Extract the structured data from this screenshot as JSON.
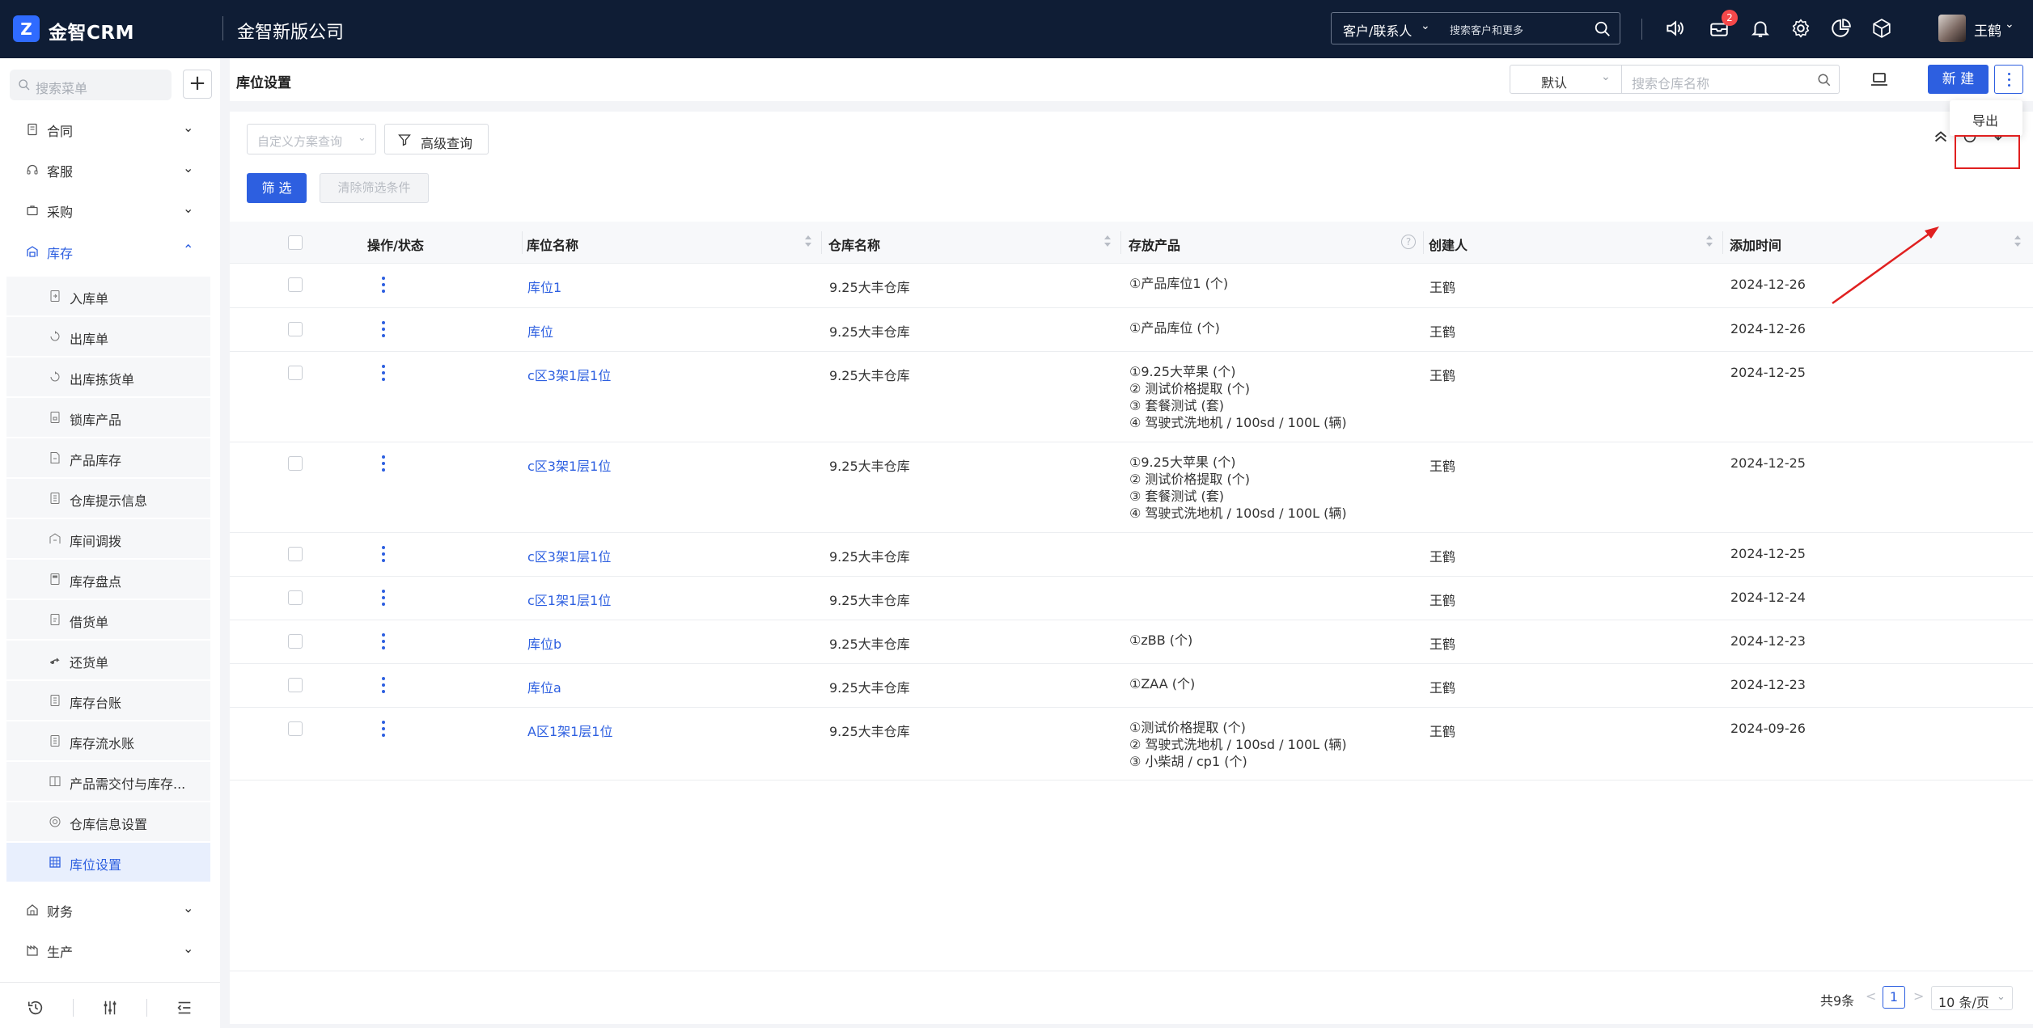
{
  "app": {
    "logo_letter": "Z",
    "brand": "金智CRM",
    "company": "金智新版公司"
  },
  "top_search": {
    "scope": "客户/联系人",
    "placeholder": "搜索客户和更多"
  },
  "notifications": {
    "badge_count": "2"
  },
  "user": {
    "name": "王鹤"
  },
  "sidebar": {
    "search_placeholder": "搜索菜单",
    "add_label": "+",
    "menus": [
      {
        "label": "合同",
        "chevron": "⌄"
      },
      {
        "label": "客服",
        "chevron": "⌄"
      },
      {
        "label": "采购",
        "chevron": "⌄"
      },
      {
        "label": "库存",
        "chevron": "⌃"
      },
      {
        "label": "财务",
        "chevron": "⌄"
      },
      {
        "label": "生产",
        "chevron": "⌄"
      }
    ],
    "inventory_items": [
      "入库单",
      "出库单",
      "出库拣货单",
      "锁库产品",
      "产品库存",
      "仓库提示信息",
      "库间调拨",
      "库存盘点",
      "借货单",
      "还货单",
      "库存台账",
      "库存流水账",
      "产品需交付与库存...",
      "仓库信息设置",
      "库位设置"
    ]
  },
  "header": {
    "title": "库位设置",
    "view_select": "默认",
    "warehouse_search_placeholder": "搜索仓库名称",
    "new_button": "新 建"
  },
  "dropdown": {
    "export": "导出"
  },
  "filters": {
    "scheme_placeholder": "自定义方案查询",
    "advanced_query": "高级查询",
    "apply": "筛 选",
    "clear": "清除筛选条件"
  },
  "table": {
    "columns": [
      "操作/状态",
      "库位名称",
      "仓库名称",
      "存放产品",
      "创建人",
      "添加时间"
    ],
    "rows": [
      {
        "name": "库位1",
        "warehouse": "9.25大丰仓库",
        "products": [
          "①产品库位1 (个)"
        ],
        "creator": "王鹤",
        "date": "2024-12-26"
      },
      {
        "name": "库位",
        "warehouse": "9.25大丰仓库",
        "products": [
          "①产品库位 (个)"
        ],
        "creator": "王鹤",
        "date": "2024-12-26"
      },
      {
        "name": "c区3架1层1位",
        "warehouse": "9.25大丰仓库",
        "products": [
          "①9.25大苹果 (个)",
          "② 测试价格提取 (个)",
          "③ 套餐测试 (套)",
          "④ 驾驶式洗地机 / 100sd / 100L (辆)"
        ],
        "creator": "王鹤",
        "date": "2024-12-25"
      },
      {
        "name": "c区3架1层1位",
        "warehouse": "9.25大丰仓库",
        "products": [
          "①9.25大苹果 (个)",
          "② 测试价格提取 (个)",
          "③ 套餐测试 (套)",
          "④ 驾驶式洗地机 / 100sd / 100L (辆)"
        ],
        "creator": "王鹤",
        "date": "2024-12-25"
      },
      {
        "name": "c区3架1层1位",
        "warehouse": "9.25大丰仓库",
        "products": [],
        "creator": "王鹤",
        "date": "2024-12-25"
      },
      {
        "name": "c区1架1层1位",
        "warehouse": "9.25大丰仓库",
        "products": [],
        "creator": "王鹤",
        "date": "2024-12-24"
      },
      {
        "name": "库位b",
        "warehouse": "9.25大丰仓库",
        "products": [
          "①zBB (个)"
        ],
        "creator": "王鹤",
        "date": "2024-12-23"
      },
      {
        "name": "库位a",
        "warehouse": "9.25大丰仓库",
        "products": [
          "①ZAA (个)"
        ],
        "creator": "王鹤",
        "date": "2024-12-23"
      },
      {
        "name": "A区1架1层1位",
        "warehouse": "9.25大丰仓库",
        "products": [
          "①测试价格提取 (个)",
          "② 驾驶式洗地机 / 100sd / 100L (辆)",
          "③ 小柴胡 / cp1 (个)"
        ],
        "creator": "王鹤",
        "date": "2024-09-26"
      }
    ]
  },
  "pagination": {
    "total": "共9条",
    "prev": "<",
    "page": "1",
    "next": ">",
    "page_size": "10 条/页"
  },
  "colors": {
    "topbar": "#0f1d35",
    "primary": "#2d5fe0",
    "annotation": "#e02020"
  }
}
